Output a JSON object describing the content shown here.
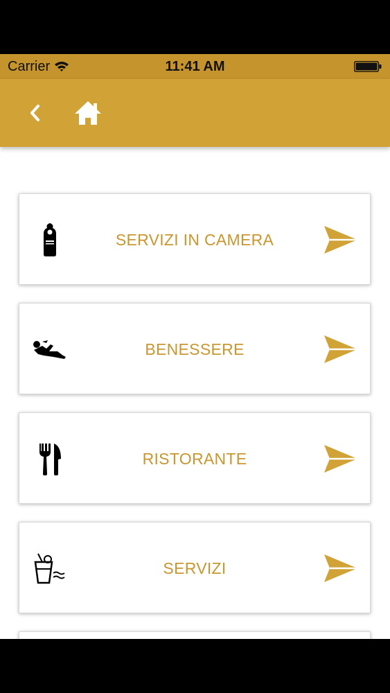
{
  "status_bar": {
    "carrier": "Carrier",
    "time": "11:41 AM"
  },
  "nav": {
    "back_icon": "chevron-left-icon",
    "home_icon": "home-icon"
  },
  "colors": {
    "accent": "#d1a235",
    "status_bar": "#c6942d",
    "label": "#c9962f"
  },
  "menu": {
    "items": [
      {
        "label": "SERVIZI IN CAMERA",
        "icon": "door-hanger-icon",
        "arrow_icon": "send-arrow-icon"
      },
      {
        "label": "BENESSERE",
        "icon": "relaxing-person-icon",
        "arrow_icon": "send-arrow-icon"
      },
      {
        "label": "RISTORANTE",
        "icon": "fork-knife-icon",
        "arrow_icon": "send-arrow-icon"
      },
      {
        "label": "SERVIZI",
        "icon": "drink-pool-icon",
        "arrow_icon": "send-arrow-icon"
      }
    ]
  }
}
